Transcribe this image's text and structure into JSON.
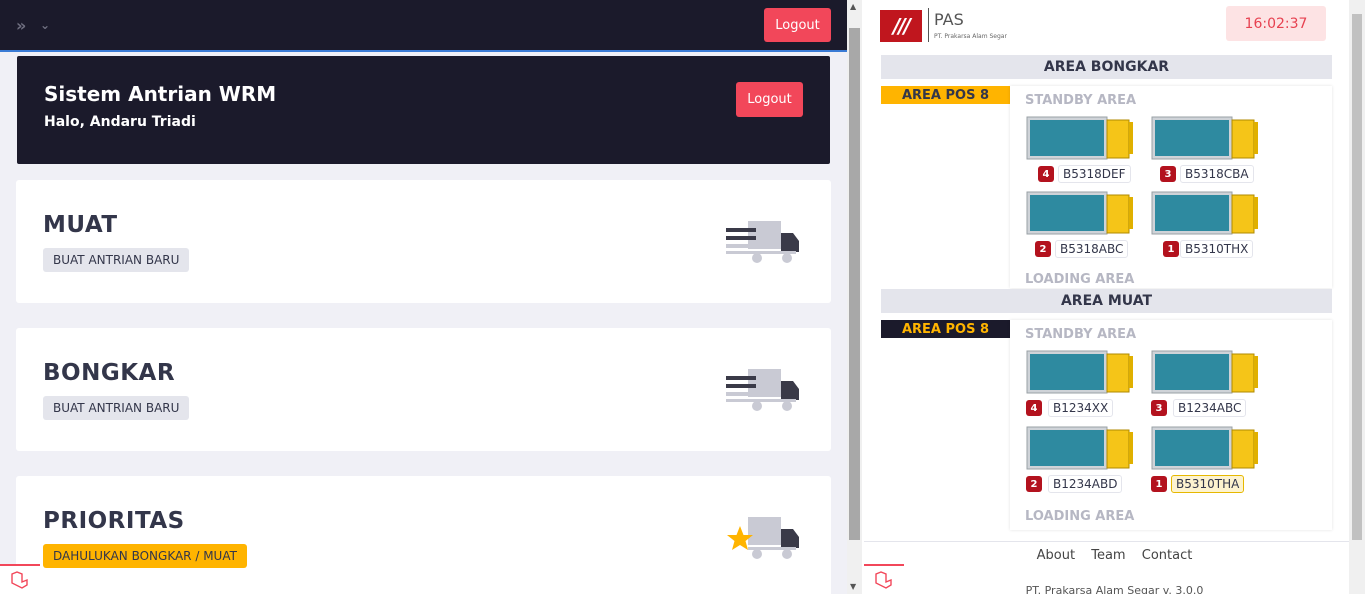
{
  "left": {
    "topbar": {
      "logout_label": "Logout"
    },
    "hero": {
      "title": "Sistem Antrian WRM",
      "greeting": "Halo, Andaru Triadi",
      "logout_label": "Logout"
    },
    "cards": [
      {
        "title": "MUAT",
        "badge": "BUAT ANTRIAN BARU",
        "icon": "truck-icon"
      },
      {
        "title": "BONGKAR",
        "badge": "BUAT ANTRIAN BARU",
        "icon": "truck-icon"
      },
      {
        "title": "PRIORITAS",
        "badge": "DAHULUKAN BONGKAR / MUAT",
        "icon": "truck-star-icon"
      }
    ]
  },
  "right": {
    "brand": {
      "name": "PAS",
      "subtitle": "PT. Prakarsa Alam Segar",
      "mark": "///"
    },
    "clock": "16:02:37",
    "bongkar": {
      "header": "AREA BONGKAR",
      "pos": "AREA POS 8",
      "standby_label": "STANDBY AREA",
      "loading_label": "LOADING AREA",
      "slots": [
        {
          "num": "4",
          "plate": "B5318DEF"
        },
        {
          "num": "3",
          "plate": "B5318CBA"
        },
        {
          "num": "2",
          "plate": "B5318ABC"
        },
        {
          "num": "1",
          "plate": "B5310THX"
        }
      ]
    },
    "muat": {
      "header": "AREA MUAT",
      "pos": "AREA POS 8",
      "standby_label": "STANDBY AREA",
      "loading_label": "LOADING AREA",
      "slots": [
        {
          "num": "4",
          "plate": "B1234XX"
        },
        {
          "num": "3",
          "plate": "B1234ABC"
        },
        {
          "num": "2",
          "plate": "B1234ABD"
        },
        {
          "num": "1",
          "plate": "B5310THA"
        }
      ]
    },
    "footer": {
      "links": [
        "About",
        "Team",
        "Contact"
      ],
      "copyright": "PT. Prakarsa Alam Segar v. 3.0.0"
    }
  },
  "colors": {
    "dark": "#1b1a2b",
    "red": "#f2475a",
    "yellow": "#ffb400",
    "badge_red": "#b3121e"
  }
}
